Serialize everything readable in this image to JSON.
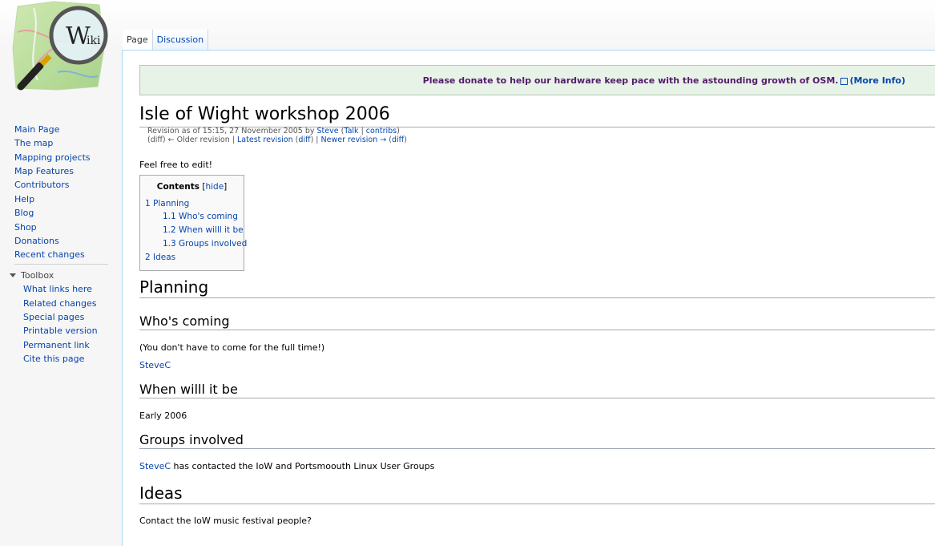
{
  "colors": {
    "link": "#0645ad",
    "notice_bg": "#e8f3e8",
    "notice_text": "#551a6b",
    "content_border": "#a7d7f9"
  },
  "logo": {
    "text": "Wiki",
    "icon": "magnifier-map-logo-icon"
  },
  "tabs": [
    {
      "label": "Page",
      "selected": true
    },
    {
      "label": "Discussion",
      "selected": false
    }
  ],
  "sidebar": {
    "navigation": [
      "Main Page",
      "The map",
      "Mapping projects",
      "Map Features",
      "Contributors",
      "Help",
      "Blog",
      "Shop",
      "Donations",
      "Recent changes"
    ],
    "toolbox_title": "Toolbox",
    "toolbox": [
      "What links here",
      "Related changes",
      "Special pages",
      "Printable version",
      "Permanent link",
      "Cite this page"
    ]
  },
  "sitenotice": {
    "text": "Please donate to help our hardware keep pace with the astounding growth of OSM.",
    "more": "(More Info)"
  },
  "page": {
    "title": "Isle of Wight workshop 2006",
    "revision": {
      "prefix": "Revision as of 15:15, 27 November 2005 by ",
      "user": "Steve",
      "open": " (",
      "talk": "Talk",
      "sep": " | ",
      "contribs": "contribs",
      "close": ")",
      "line2_a": "(diff) ← Older revision | ",
      "latest": "Latest revision",
      "line2_b": " (",
      "diff1": "diff",
      "line2_c": ") | ",
      "newer": "Newer revision →",
      "line2_d": " (",
      "diff2": "diff",
      "line2_e": ")"
    },
    "intro": "Feel free to edit!",
    "toc": {
      "title": "Contents",
      "hide": "hide",
      "items": [
        "1 Planning",
        "1.1 Who's coming",
        "1.2 When willl it be",
        "1.3 Groups involved",
        "2 Ideas"
      ]
    },
    "sections": {
      "planning": "Planning",
      "whos_coming": "Who's coming",
      "whos_coming_note": "(You don't have to come for the full time!)",
      "stevec_link": "SteveC",
      "when": "When willl it be",
      "when_text": "Early 2006",
      "groups": "Groups involved",
      "groups_link": "SteveC",
      "groups_text": " has contacted the IoW and Portsmoouth Linux User Groups",
      "ideas": "Ideas",
      "ideas_text": "Contact the IoW music festival people?"
    }
  }
}
